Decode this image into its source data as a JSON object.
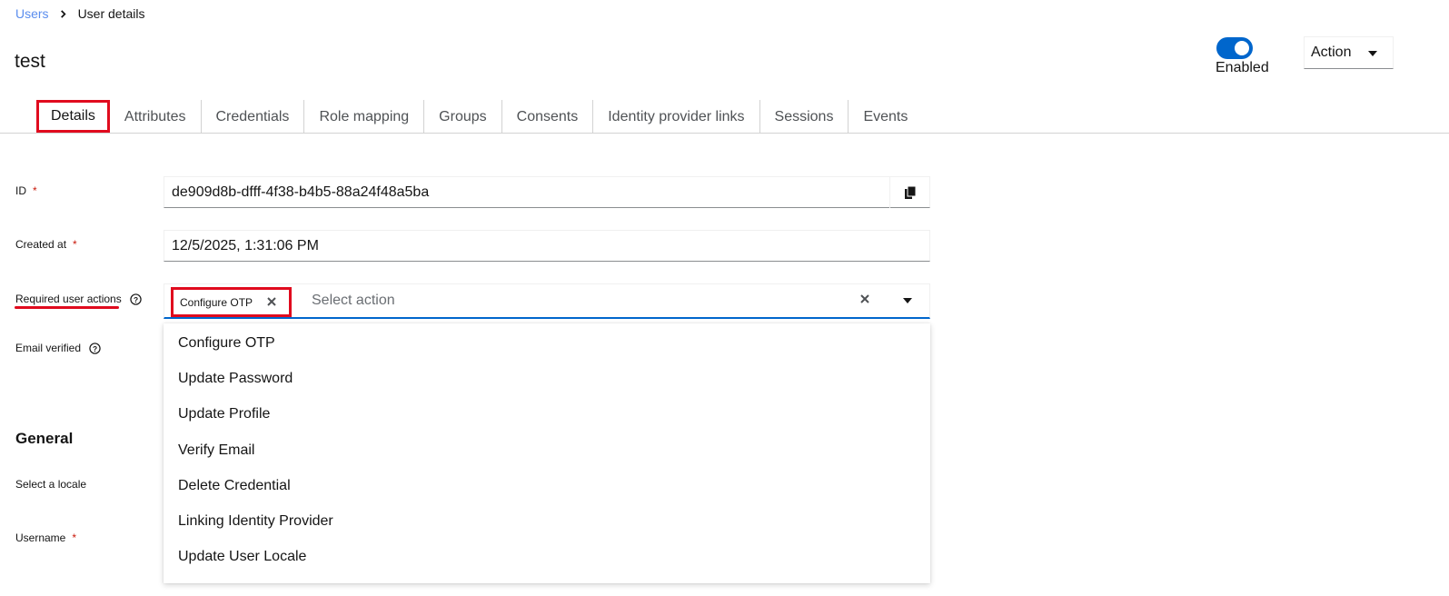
{
  "breadcrumb": {
    "parent": "Users",
    "current": "User details"
  },
  "page_title": "test",
  "header": {
    "enabled_label": "Enabled",
    "enabled": true,
    "action_label": "Action"
  },
  "tabs": [
    {
      "label": "Details",
      "active": true
    },
    {
      "label": "Attributes"
    },
    {
      "label": "Credentials"
    },
    {
      "label": "Role mapping"
    },
    {
      "label": "Groups"
    },
    {
      "label": "Consents"
    },
    {
      "label": "Identity provider links"
    },
    {
      "label": "Sessions"
    },
    {
      "label": "Events"
    }
  ],
  "form": {
    "id_label": "ID",
    "id_value": "de909d8b-dfff-4f38-b4b5-88a24f48a5ba",
    "created_label": "Created at",
    "created_value": "12/5/2025, 1:31:06 PM",
    "required_actions_label": "Required user actions",
    "required_actions_chip": "Configure OTP",
    "required_actions_placeholder": "Select action",
    "email_verified_label": "Email verified",
    "general_title": "General",
    "locale_label": "Select a locale",
    "username_label": "Username"
  },
  "menu_options": [
    "Configure OTP",
    "Update Password",
    "Update Profile",
    "Verify Email",
    "Delete Credential",
    "Linking Identity Provider",
    "Update User Locale"
  ],
  "colors": {
    "accent": "#0066cc",
    "highlight": "#e00b1e",
    "link": "#5a8dee",
    "required": "#c9190b"
  }
}
